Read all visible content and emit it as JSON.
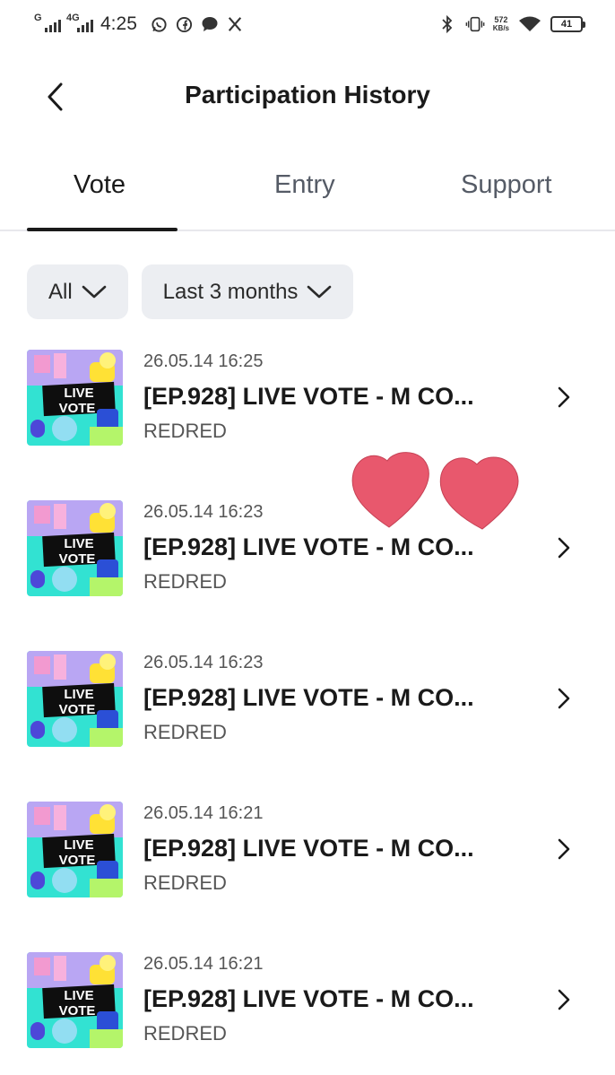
{
  "status_bar": {
    "time": "4:25",
    "network_1": "G",
    "network_2": "4G",
    "apps": [
      "whatsapp-icon",
      "facebook-icon",
      "chat-bubble-icon",
      "x-icon"
    ],
    "speed_value": "572",
    "speed_unit": "KB/s",
    "battery_level": "41"
  },
  "header": {
    "title": "Participation History"
  },
  "tabs": [
    {
      "label": "Vote",
      "active": true
    },
    {
      "label": "Entry",
      "active": false
    },
    {
      "label": "Support",
      "active": false
    }
  ],
  "filters": {
    "type": "All",
    "period": "Last 3 months"
  },
  "items": [
    {
      "date": "26.05.14 16:25",
      "title": "[EP.928] LIVE VOTE - M CO...",
      "artist": "REDRED",
      "thumb_text_1": "LIVE",
      "thumb_text_2": "VOTE"
    },
    {
      "date": "26.05.14 16:23",
      "title": "[EP.928] LIVE VOTE - M CO...",
      "artist": "REDRED",
      "thumb_text_1": "LIVE",
      "thumb_text_2": "VOTE"
    },
    {
      "date": "26.05.14 16:23",
      "title": "[EP.928] LIVE VOTE - M CO...",
      "artist": "REDRED",
      "thumb_text_1": "LIVE",
      "thumb_text_2": "VOTE"
    },
    {
      "date": "26.05.14 16:21",
      "title": "[EP.928] LIVE VOTE - M CO...",
      "artist": "REDRED",
      "thumb_text_1": "LIVE",
      "thumb_text_2": "VOTE"
    },
    {
      "date": "26.05.14 16:21",
      "title": "[EP.928] LIVE VOTE - M CO...",
      "artist": "REDRED",
      "thumb_text_1": "LIVE",
      "thumb_text_2": "VOTE"
    }
  ],
  "colors": {
    "heart": "#e8586d",
    "chip_bg": "#eceef2",
    "thumb_teal": "#21d8d0",
    "thumb_pink": "#f29ad0",
    "thumb_yellow": "#ffe135"
  }
}
